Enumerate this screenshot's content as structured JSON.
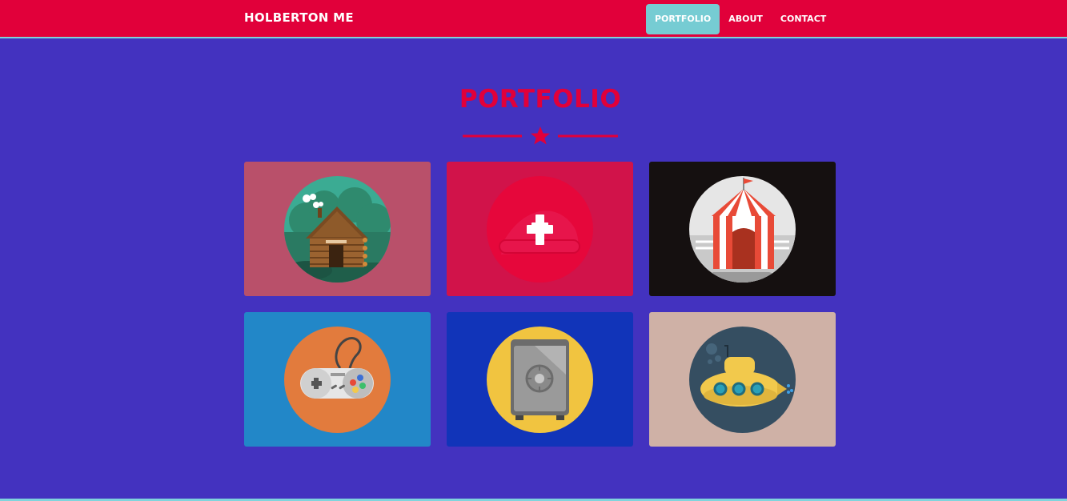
{
  "brand": "HOLBERTON ME",
  "nav": {
    "items": [
      {
        "label": "PORTFOLIO",
        "active": true
      },
      {
        "label": "ABOUT",
        "active": false
      },
      {
        "label": "CONTACT",
        "active": false
      }
    ]
  },
  "section": {
    "title": "PORTFOLIO"
  },
  "portfolio": {
    "items": [
      {
        "icon": "cabin-icon",
        "bg": "#b9506a"
      },
      {
        "icon": "cake-icon",
        "bg": "#d1134a"
      },
      {
        "icon": "circus-tent-icon",
        "bg": "#151010"
      },
      {
        "icon": "game-controller-icon",
        "bg": "#2287c8"
      },
      {
        "icon": "safe-icon",
        "bg": "#1134b9"
      },
      {
        "icon": "submarine-icon",
        "bg": "#cfb1a6"
      }
    ]
  },
  "colors": {
    "background": "#4332bf",
    "accent": "#e1003a",
    "nav_active": "#76ccd3"
  }
}
